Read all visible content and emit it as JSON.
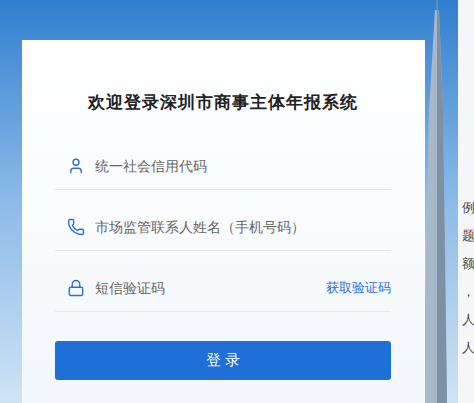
{
  "login": {
    "title": "欢迎登录深圳市商事主体年报系统",
    "fields": [
      {
        "kind": "text",
        "placeholder": "统一社会信用代码"
      },
      {
        "kind": "phone",
        "placeholder": "市场监管联系人姓名（手机号码）"
      },
      {
        "kind": "code",
        "placeholder": "短信验证码",
        "action": "获取验证码"
      }
    ],
    "submit": "登 录"
  },
  "background_text": [
    "例",
    "题",
    "额",
    "，",
    "人",
    "人"
  ]
}
